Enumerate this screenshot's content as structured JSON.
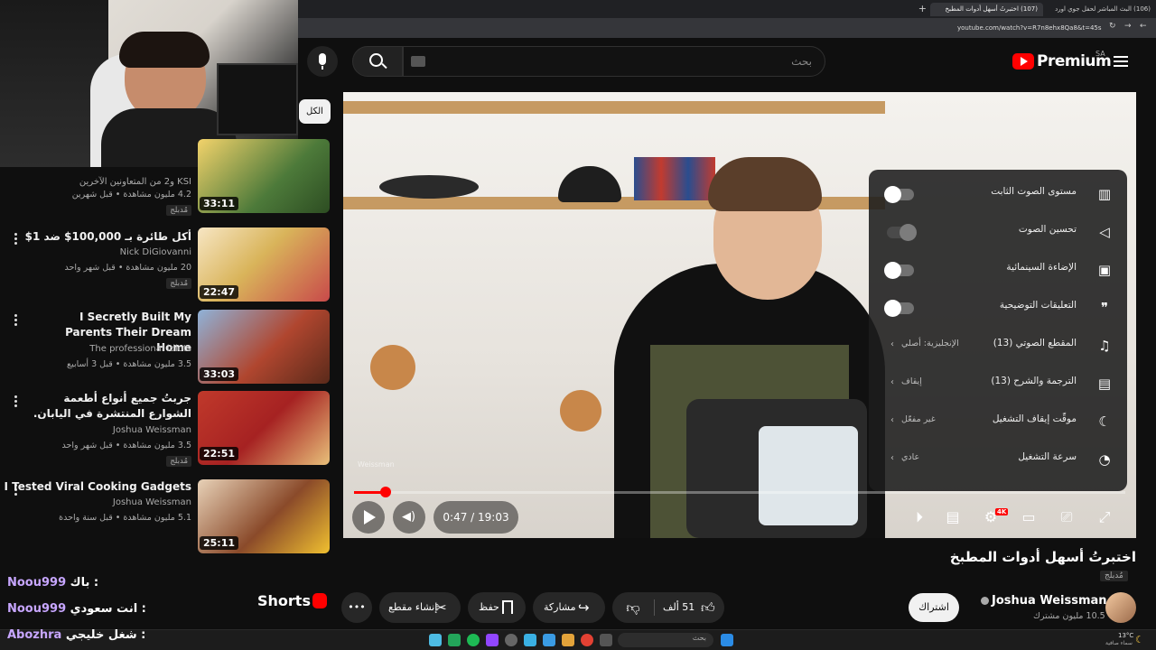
{
  "browser": {
    "tabs": [
      {
        "label": "(106) البث المباشر لحفل جوي اورد"
      },
      {
        "label": "(107) اختبرتُ أسهل أدوات المطبخ"
      }
    ],
    "url": "youtube.com/watch?v=R7n8ehx8Qa8&t=45s"
  },
  "header": {
    "logo_label": "Premium",
    "logo_region": "SA",
    "search_placeholder": "بحث"
  },
  "filter_chip": "الكل",
  "recommendations": [
    {
      "title": "KSI و2 من المتعاونين الآخرين",
      "channel": "",
      "meta": "4.2 مليون مشاهدة • قبل شهرين",
      "badge": "مُدبلج",
      "duration": "33:11",
      "thumb_color": "#4d7a3a"
    },
    {
      "title": "أكل طائرة بـ 100,000$ ضد 1$",
      "channel": "Nick DiGiovanni",
      "meta": "20 مليون مشاهدة • قبل شهر واحد",
      "badge": "مُدبلج",
      "duration": "22:47",
      "thumb_color": "#d9b45a"
    },
    {
      "title": "I Secretly Built My Parents Their Dream Home",
      "channel": "The professional idiots",
      "meta": "3.5 مليون مشاهدة • قبل 3 أسابيع",
      "badge": "",
      "duration": "33:03",
      "thumb_color": "#b0462f"
    },
    {
      "title": "جربتُ جميع أنواع أطعمة الشوارع المنتشرة في اليابان.",
      "channel": "Joshua Weissman",
      "meta": "3.5 مليون مشاهدة • قبل شهر واحد",
      "badge": "مُدبلج",
      "duration": "22:51",
      "thumb_color": "#a62222"
    },
    {
      "title": "I Tested Viral Cooking Gadgets",
      "channel": "Joshua Weissman",
      "meta": "5.1 مليون مشاهدة • قبل سنة واحدة",
      "badge": "",
      "duration": "25:11",
      "thumb_color": "#8a4a2a"
    }
  ],
  "shorts_label": "Shorts",
  "player": {
    "current_time": "0:47",
    "total_time": "19:03",
    "time_display": "0:47 / 19:03",
    "progress_fraction": 0.0411,
    "quality_badge": "4K",
    "watermark": "Weissman"
  },
  "settings": [
    {
      "label": "مستوى الصوت الثابت",
      "type": "toggle",
      "icon": "stable-volume-icon"
    },
    {
      "label": "تحسين الصوت",
      "type": "toggle-disabled",
      "icon": "voice-boost-icon"
    },
    {
      "label": "الإضاءة السينمائية",
      "type": "toggle",
      "icon": "ambient-mode-icon"
    },
    {
      "label": "التعليقات التوضيحية",
      "type": "toggle",
      "icon": "annotations-icon"
    },
    {
      "label": "المقطع الصوتي (13)",
      "value": "الإنجليزية: أصلي",
      "type": "submenu",
      "icon": "audio-track-icon"
    },
    {
      "label": "الترجمة والشرح (13)",
      "value": "إيقاف",
      "type": "submenu",
      "icon": "subtitles-icon"
    },
    {
      "label": "موقّت إيقاف التشغيل",
      "value": "غير مفعّل",
      "type": "submenu",
      "icon": "sleep-timer-icon"
    },
    {
      "label": "سرعة التشغيل",
      "value": "عادي",
      "type": "submenu",
      "icon": "playback-speed-icon"
    }
  ],
  "video": {
    "title": "اختبرتُ أسهل أدوات المطبخ",
    "dub_badge": "مُدبلج",
    "channel": "Joshua Weissman",
    "subscribers": "10.5 مليون مشترك",
    "subscribe_label": "اشتراك",
    "likes": "51 ألف",
    "share_label": "مشاركة",
    "save_label": "حفظ",
    "clip_label": "إنشاء مقطع"
  },
  "chat": [
    {
      "user": "Noou999",
      "message": "باك :"
    },
    {
      "user": "Noou999",
      "message": "انت سعودي :"
    },
    {
      "user": "Abozhra",
      "message": "شغل خليجي :"
    }
  ],
  "taskbar": {
    "search_placeholder": "بحث",
    "weather_temp": "13°C",
    "weather_text": "سماء صافية"
  },
  "colors": {
    "accent": "#ff0000",
    "background": "#0f0f0f",
    "chat_user": "#c7a6ff"
  }
}
